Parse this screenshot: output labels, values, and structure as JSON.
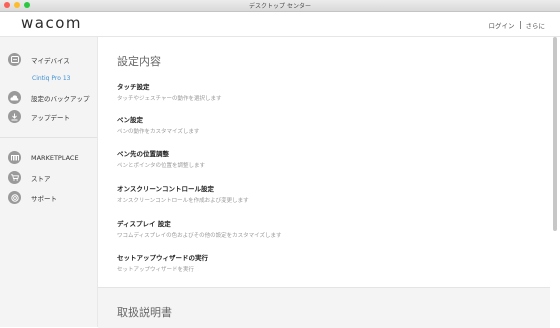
{
  "window": {
    "title": "デスクトップ センター",
    "lights": {
      "close": "#fc5f57",
      "minimize": "#fdbc2e",
      "zoom": "#29c840"
    }
  },
  "header": {
    "logo": "wacom",
    "login": "ログイン",
    "more": "さらに"
  },
  "sidebar": {
    "my_devices": {
      "label": "マイデバイス",
      "icon": "tablet-icon"
    },
    "device_name": "Cintiq Pro 13",
    "backup": {
      "label": "設定のバックアップ",
      "icon": "cloud-icon"
    },
    "update": {
      "label": "アップデート",
      "icon": "download-icon"
    },
    "marketplace": {
      "label": "MARKETPLACE",
      "icon": "marketplace-icon"
    },
    "store": {
      "label": "ストア",
      "icon": "cart-icon"
    },
    "support": {
      "label": "サポート",
      "icon": "lifebuoy-icon"
    }
  },
  "main": {
    "section_title": "設定内容",
    "items": [
      {
        "title": "タッチ設定",
        "desc": "タッチやジェスチャーの動作を選択します"
      },
      {
        "title": "ペン設定",
        "desc": "ペンの動作をカスタマイズします"
      },
      {
        "title": "ペン先の位置調整",
        "desc": "ペンとポインタの位置を調整します"
      },
      {
        "title": "オンスクリーンコントロール設定",
        "desc": "オンスクリーンコントロールを作成および変更します"
      },
      {
        "title": "ディスプレイ 設定",
        "desc": "ワコムディスプレイの色およびその他の設定をカスタマイズします"
      },
      {
        "title": "セットアップウィザードの実行",
        "desc": "セットアップウィザードを実行"
      }
    ],
    "manual_title": "取扱説明書"
  }
}
